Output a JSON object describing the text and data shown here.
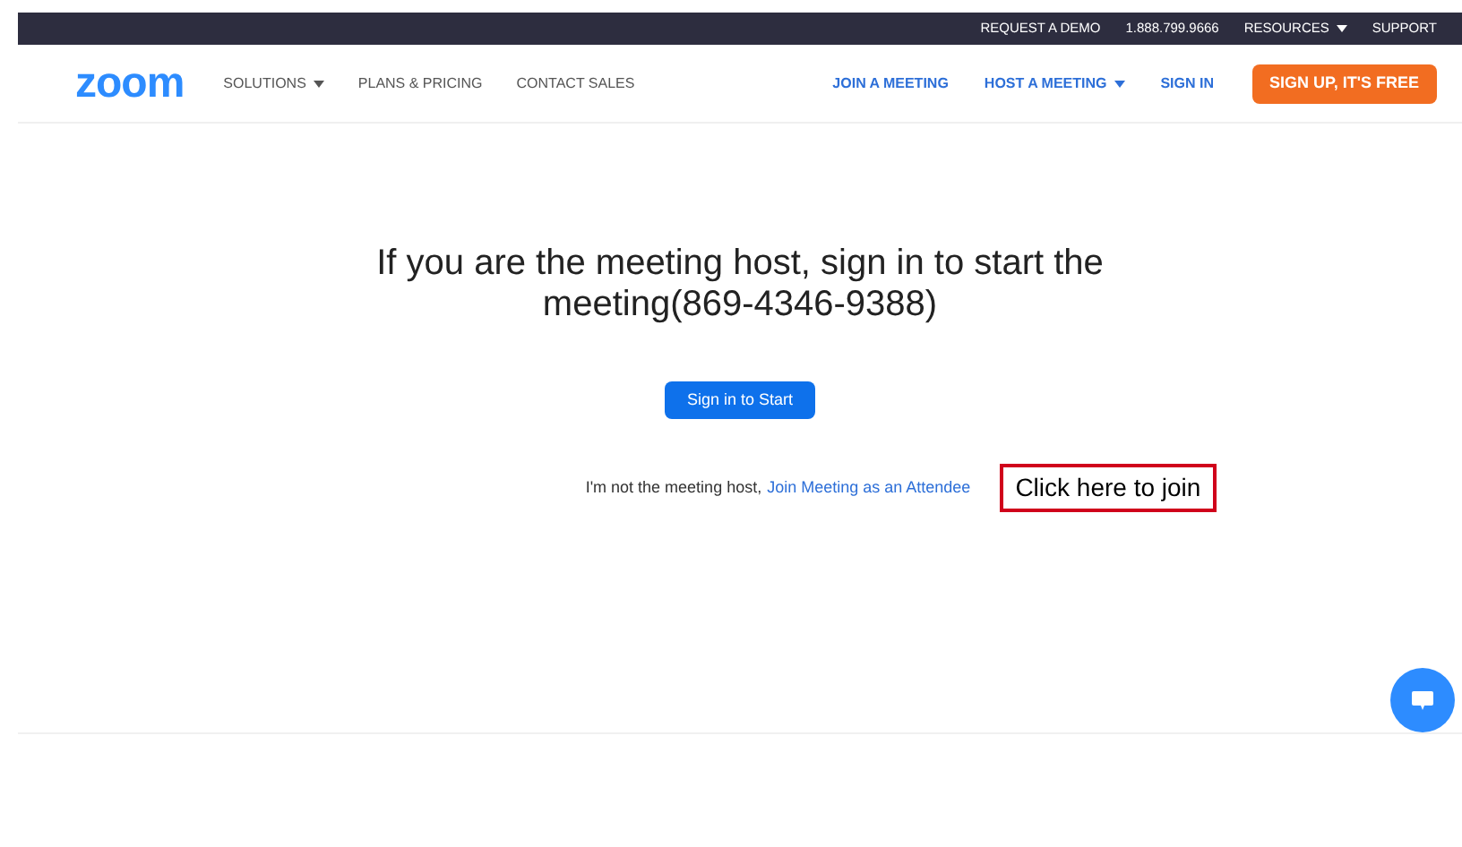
{
  "top_bar": {
    "items": [
      {
        "label": "REQUEST A DEMO",
        "dropdown": false
      },
      {
        "label": "1.888.799.9666",
        "dropdown": false
      },
      {
        "label": "RESOURCES",
        "dropdown": true
      },
      {
        "label": "SUPPORT",
        "dropdown": false
      }
    ]
  },
  "nav": {
    "logo": "zoom",
    "left_items": [
      {
        "label": "SOLUTIONS",
        "dropdown": true
      },
      {
        "label": "PLANS & PRICING",
        "dropdown": false
      },
      {
        "label": "CONTACT SALES",
        "dropdown": false
      }
    ],
    "right_items": [
      {
        "label": "JOIN A MEETING",
        "dropdown": false
      },
      {
        "label": "HOST A MEETING",
        "dropdown": true
      },
      {
        "label": "SIGN IN",
        "dropdown": false
      }
    ],
    "signup_button": "SIGN UP, IT'S FREE"
  },
  "main": {
    "heading": "If you are the meeting host, sign in to start the meeting(869-4346-9388)",
    "start_button": "Sign in to Start",
    "note": "I'm not the meeting host,",
    "attendee_link": "Join Meeting as an Attendee",
    "annotation": "Click here to join"
  }
}
